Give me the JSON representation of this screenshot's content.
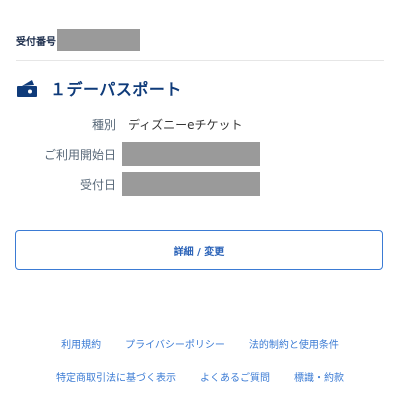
{
  "receipt": {
    "label": "受付番号"
  },
  "ticket": {
    "icon": "ticket-icon",
    "title": "１デーパスポート"
  },
  "details": {
    "type_label": "種別",
    "type_value": "ディズニーeチケット",
    "start_label": "ご利用開始日",
    "accept_label": "受付日"
  },
  "actions": {
    "details_button": "詳細 / 変更"
  },
  "footer": {
    "terms": "利用規約",
    "privacy": "プライバシーポリシー",
    "legal": "法的制約と使用条件",
    "commerce": "特定商取引法に基づく表示",
    "faq": "よくあるご質問",
    "signs": "標識・約款"
  },
  "colors": {
    "accent": "#3b7bd4",
    "title": "#0f3b7a",
    "redaction": "#9a9a9a"
  }
}
